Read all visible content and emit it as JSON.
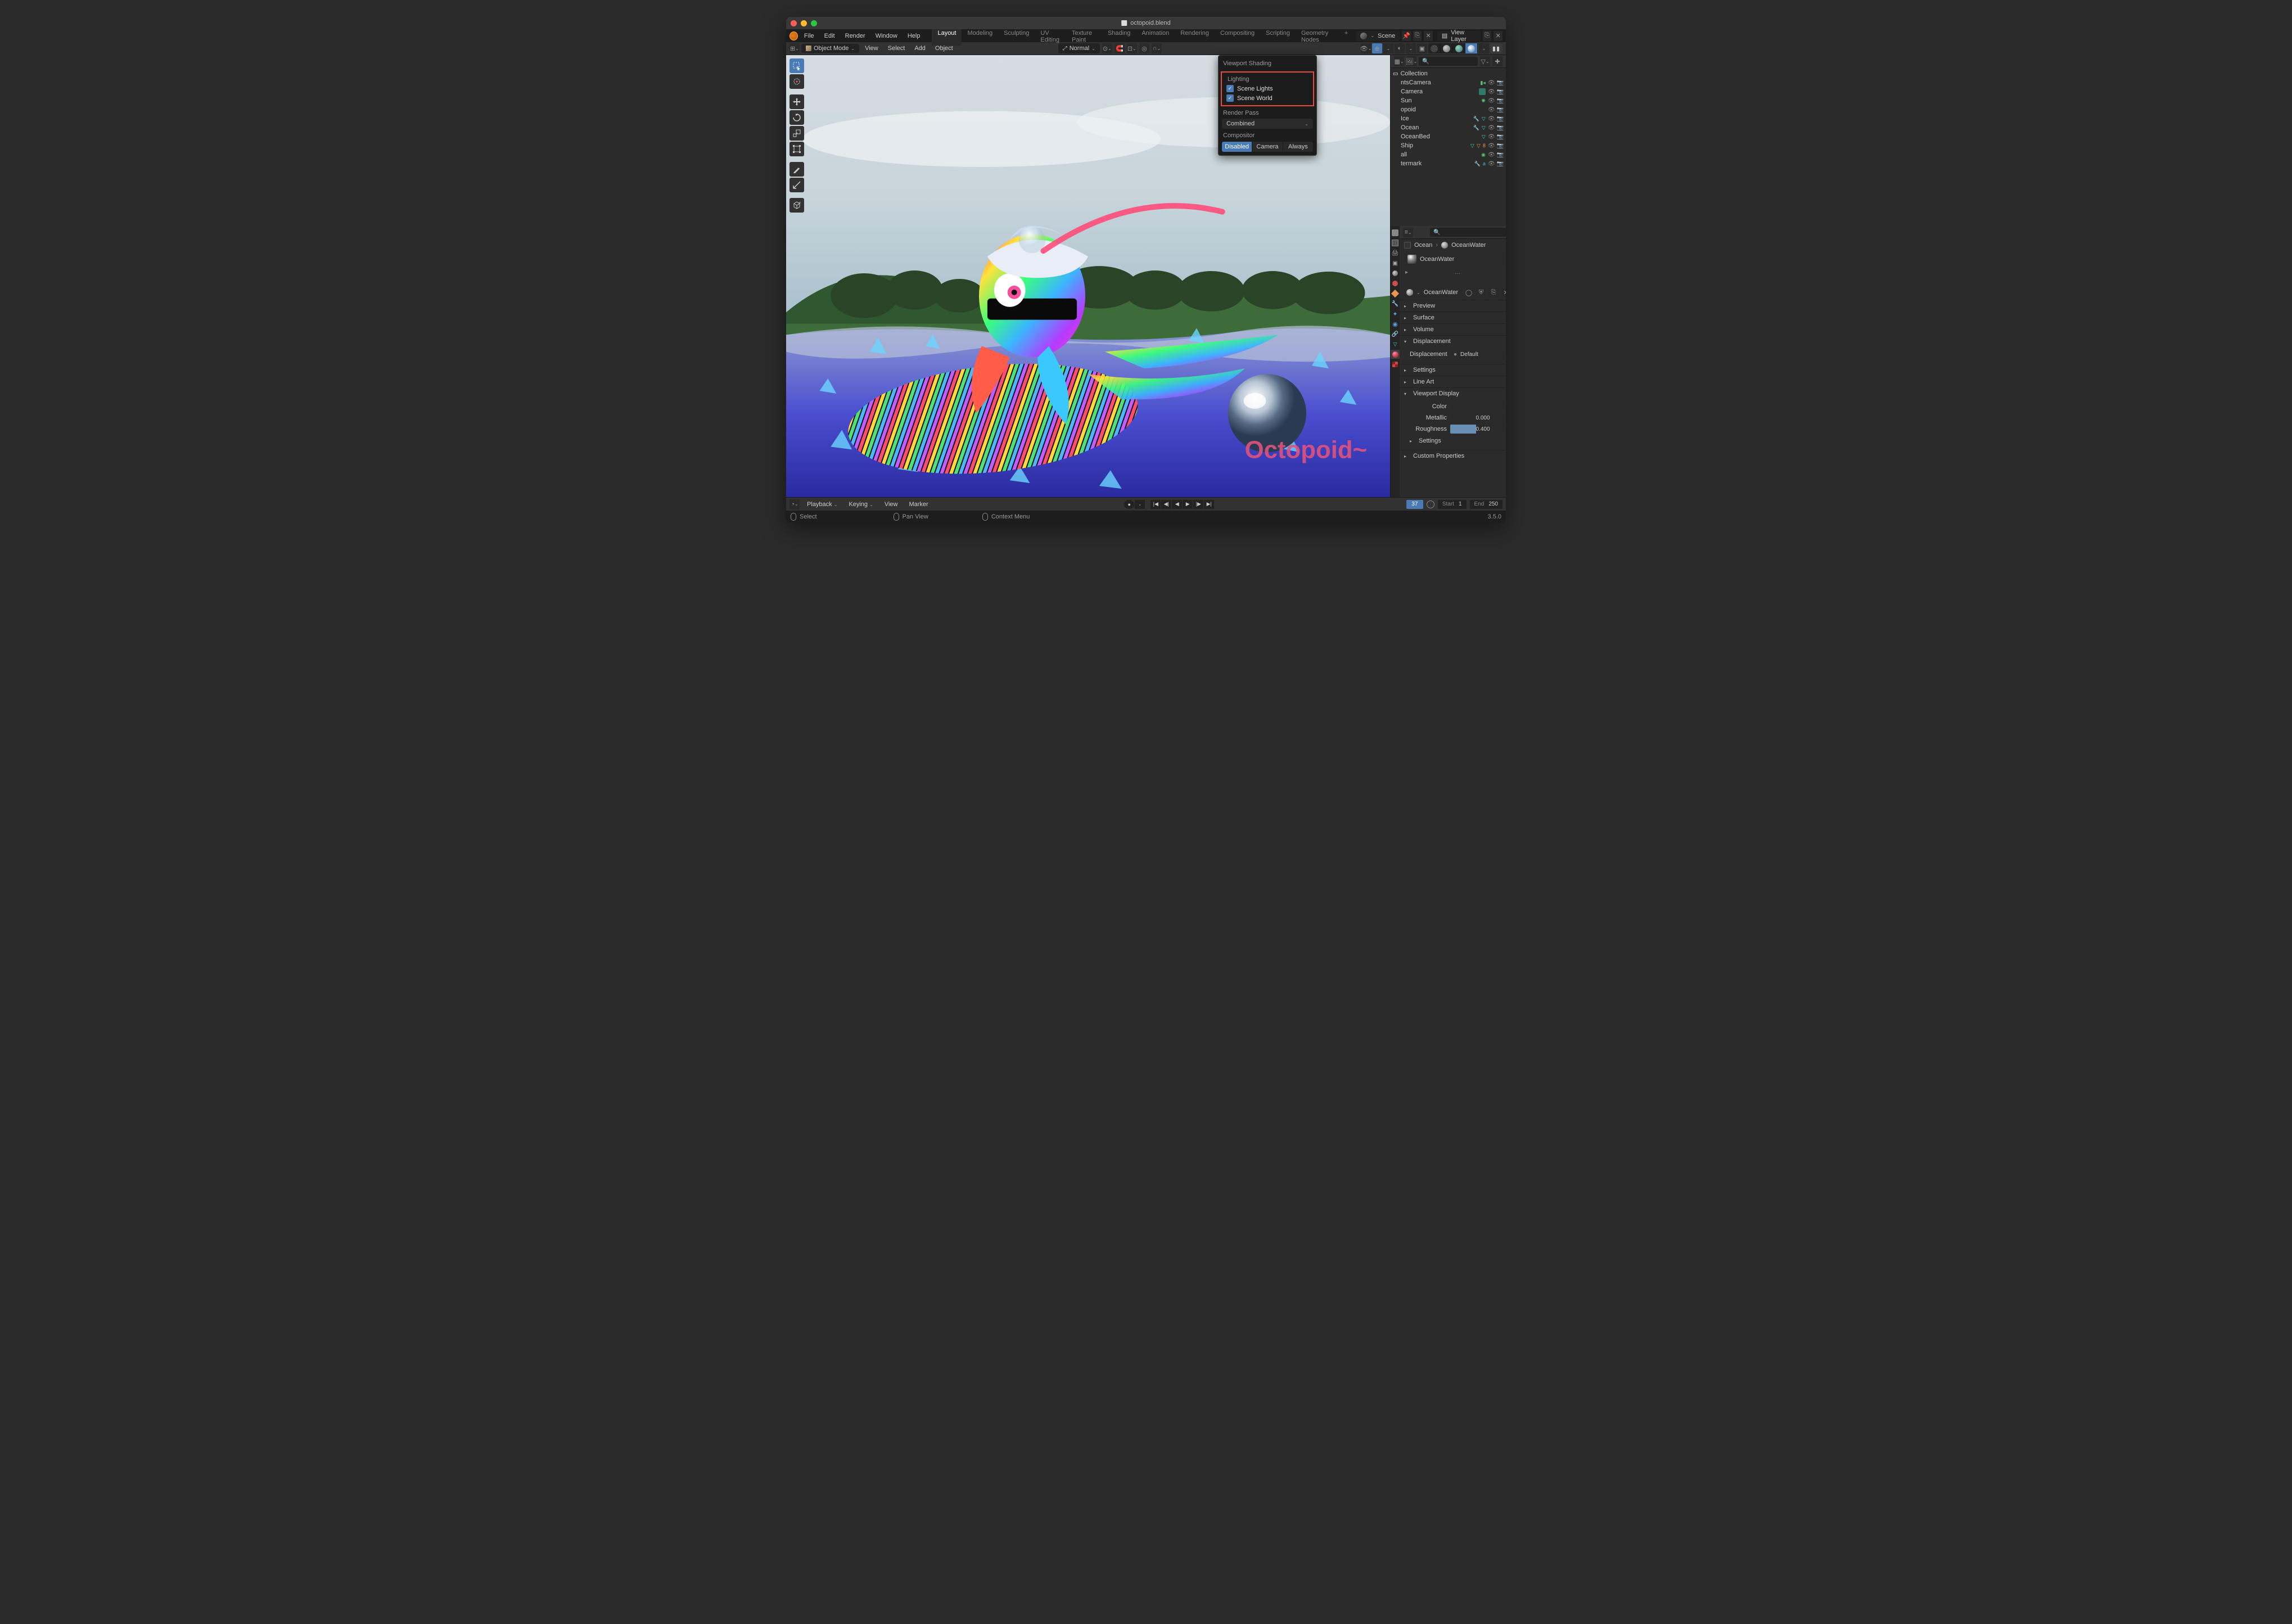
{
  "title": "octopoid.blend",
  "menus": [
    "File",
    "Edit",
    "Render",
    "Window",
    "Help"
  ],
  "workspaces": [
    "Layout",
    "Modeling",
    "Sculpting",
    "UV Editing",
    "Texture Paint",
    "Shading",
    "Animation",
    "Rendering",
    "Compositing",
    "Scripting",
    "Geometry Nodes"
  ],
  "active_workspace": "Layout",
  "scene": "Scene",
  "view_layer": "View Layer",
  "mode": "Object Mode",
  "main_menus": [
    "View",
    "Select",
    "Add",
    "Object"
  ],
  "orientation": "Normal",
  "popover": {
    "title": "Viewport Shading",
    "lighting_label": "Lighting",
    "scene_lights": {
      "label": "Scene Lights",
      "checked": true
    },
    "scene_world": {
      "label": "Scene World",
      "checked": true
    },
    "render_pass_label": "Render Pass",
    "render_pass": "Combined",
    "compositor_label": "Compositor",
    "compositor": {
      "options": [
        "Disabled",
        "Camera",
        "Always"
      ],
      "active": "Disabled"
    }
  },
  "outliner": {
    "collection": "Collection",
    "items": [
      {
        "name": "ntsCamera",
        "icons": [
          "cam"
        ],
        "vis": true
      },
      {
        "name": "Camera",
        "icons": [
          "grid"
        ],
        "vis": true
      },
      {
        "name": "Sun",
        "icons": [
          "light"
        ],
        "vis": true
      },
      {
        "name": "opoid",
        "icons": [],
        "vis": true
      },
      {
        "name": "Ice",
        "icons": [
          "mod",
          "meshg"
        ],
        "vis": true
      },
      {
        "name": "Ocean",
        "icons": [
          "mod",
          "meshg"
        ],
        "vis": true
      },
      {
        "name": "OceanBed",
        "icons": [
          "meshg"
        ],
        "vis": true
      },
      {
        "name": "Ship",
        "icons": [
          "meshg",
          "meshor",
          "8"
        ],
        "vis": true
      },
      {
        "name": "all",
        "icons": [
          "circ"
        ],
        "vis": true
      },
      {
        "name": "termark",
        "icons": [
          "mod",
          "abc"
        ],
        "vis": true
      }
    ]
  },
  "properties": {
    "object": "Ocean",
    "material": "OceanWater",
    "panels": [
      {
        "name": "Preview",
        "open": false
      },
      {
        "name": "Surface",
        "open": false
      },
      {
        "name": "Volume",
        "open": false
      },
      {
        "name": "Displacement",
        "open": true,
        "row": {
          "label": "Displacement",
          "value": "Default"
        }
      },
      {
        "name": "Settings",
        "open": false
      },
      {
        "name": "Line Art",
        "open": false
      },
      {
        "name": "Viewport Display",
        "open": true,
        "rows": [
          {
            "label": "Color",
            "type": "color"
          },
          {
            "label": "Metallic",
            "value": "0.000",
            "fill": 0
          },
          {
            "label": "Roughness",
            "value": "0.400",
            "fill": 40
          }
        ],
        "subpanel": "Settings"
      },
      {
        "name": "Custom Properties",
        "open": false
      }
    ]
  },
  "timeline": {
    "menus": [
      "Playback",
      "Keying",
      "View",
      "Marker"
    ],
    "current": "37",
    "start_label": "Start",
    "start": "1",
    "end_label": "End",
    "end": "250"
  },
  "statusbar": {
    "hints": [
      "Select",
      "Pan View",
      "Context Menu"
    ],
    "version": "3.5.0"
  }
}
